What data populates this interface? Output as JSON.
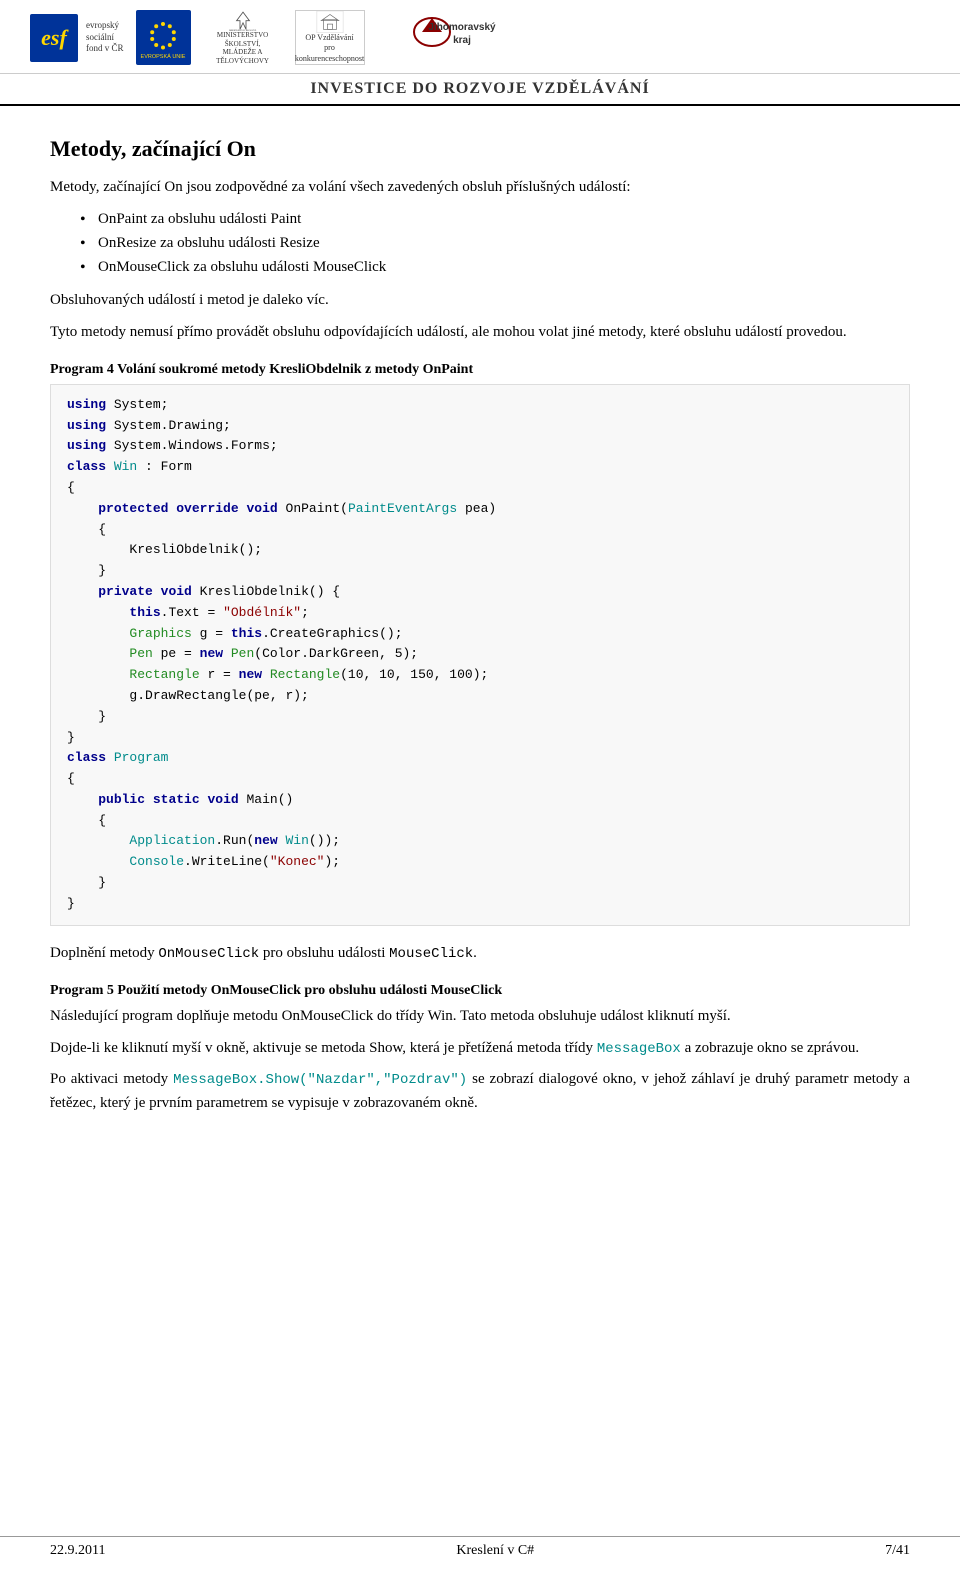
{
  "header": {
    "banner": "INVESTICE DO ROZVOJE VZDĚLÁVÁNÍ",
    "logos": {
      "esf_label": "esf",
      "esf_subtitle1": "evropský",
      "esf_subtitle2": "sociální",
      "esf_subtitle3": "fond v ČR",
      "eu_label": "EVROPSKÁ UNIE",
      "msmt_label": "MINISTERSTVO ŠKOLSTVÍ,\nMLÁDEŽE A TĚLOVÝCHOVY",
      "op_label": "OP Vzdělávání\npro konkurenceschopnost",
      "jmk_label": "Jihomoravský kraj"
    }
  },
  "page": {
    "main_title": "Metody, začínající On",
    "intro": "Metody, začínající On jsou zodpovědné za volání všech zavedených obsluh příslušných událostí:",
    "bullets": [
      "OnPaint za obsluhu události Paint",
      "OnResize za obsluhu události Resize",
      "OnMouseClick za obsluhu události MouseClick"
    ],
    "para1": "Obsluhovaných událostí i metod je daleko víc.",
    "para2": "Tyto metody nemusí přímo provádět obsluhu odpovídajících událostí, ale mohou volat jiné metody, které obsluhu událostí provedou.",
    "program4_label": "Program  4  Volání soukromé metody KresliObdelnik z metody OnPaint",
    "program5_label": "Program  5  Použití metody OnMouseClick pro obsluhu události MouseClick",
    "doplneni_text1": "Doplnění metody ",
    "doplneni_code1": "OnMouseClick",
    "doplneni_text2": " pro obsluhu události ",
    "doplneni_code2": "MouseClick",
    "doplneni_dot": ".",
    "nasledujici": "Následující program doplňuje metodu OnMouseClick do třídy Win. Tato metoda obsluhuje událost kliknutí myší.",
    "dojde": "Dojde-li ke kliknutí myší v okně, aktivuje se metoda Show, která je přetížená metoda třídy ",
    "dojde_code": "MessageBox",
    "dojde2": " a zobrazuje okno se zprávou.",
    "po_aktivaci1": "Po aktivaci metody ",
    "po_aktivaci_code": "MessageBox.Show(\"Nazdar\",\"Pozdrav\")",
    "po_aktivaci2": " se zobrazí dialogové okno, v jehož záhlaví je druhý parametr metody a řetězec, který je prvním parametrem se vypisuje v zobrazovaném okně."
  },
  "footer": {
    "date": "22.9.2011",
    "title": "Kreslení v C#",
    "page": "7/41"
  }
}
